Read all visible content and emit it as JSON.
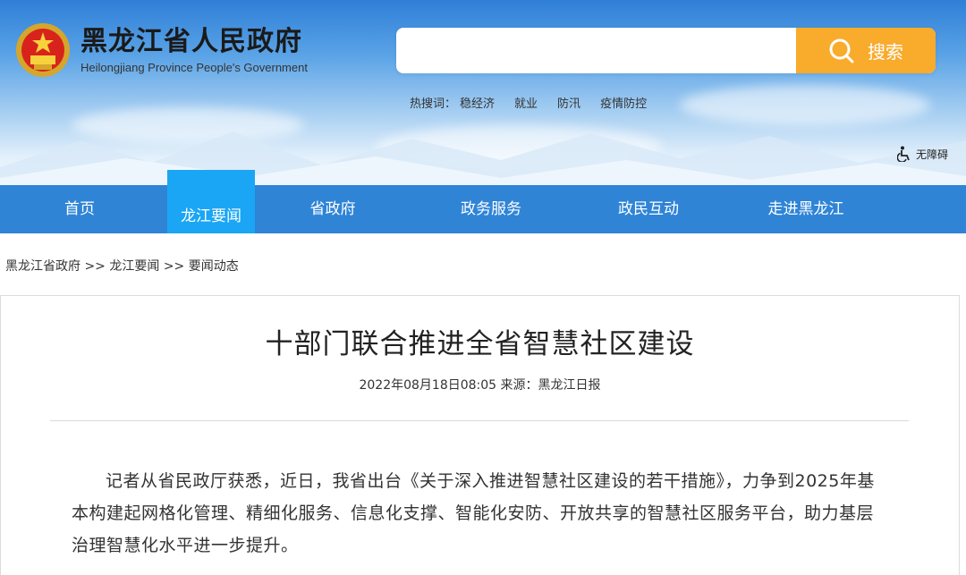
{
  "header": {
    "title": "黑龙江省人民政府",
    "subtitle": "Heilongjiang Province People's Government",
    "search_placeholder": "",
    "search_button": "搜索",
    "hot_label": "热搜词：",
    "hot_words": [
      "稳经济",
      "就业",
      "防汛",
      "疫情防控"
    ],
    "accessibility": "无障碍",
    "colors": {
      "search_button": "#f9ab2c",
      "nav": "#2f84d6",
      "nav_active": "#1aa6f4"
    }
  },
  "nav": {
    "items": [
      "首页",
      "龙江要闻",
      "省政府",
      "政务服务",
      "政民互动",
      "走进黑龙江"
    ],
    "active": "龙江要闻"
  },
  "breadcrumb": {
    "items": [
      "黑龙江省政府",
      "龙江要闻",
      "要闻动态"
    ],
    "separator": ">>"
  },
  "article": {
    "title": "十部门联合推进全省智慧社区建设",
    "meta": "2022年08月18日08:05  来源：黑龙江日报",
    "paragraph": "记者从省民政厅获悉，近日，我省出台《关于深入推进智慧社区建设的若干措施》，力争到2025年基本构建起网格化管理、精细化服务、信息化支撑、智能化安防、开放共享的智慧社区服务平台，助力基层治理智慧化水平进一步提升。"
  }
}
